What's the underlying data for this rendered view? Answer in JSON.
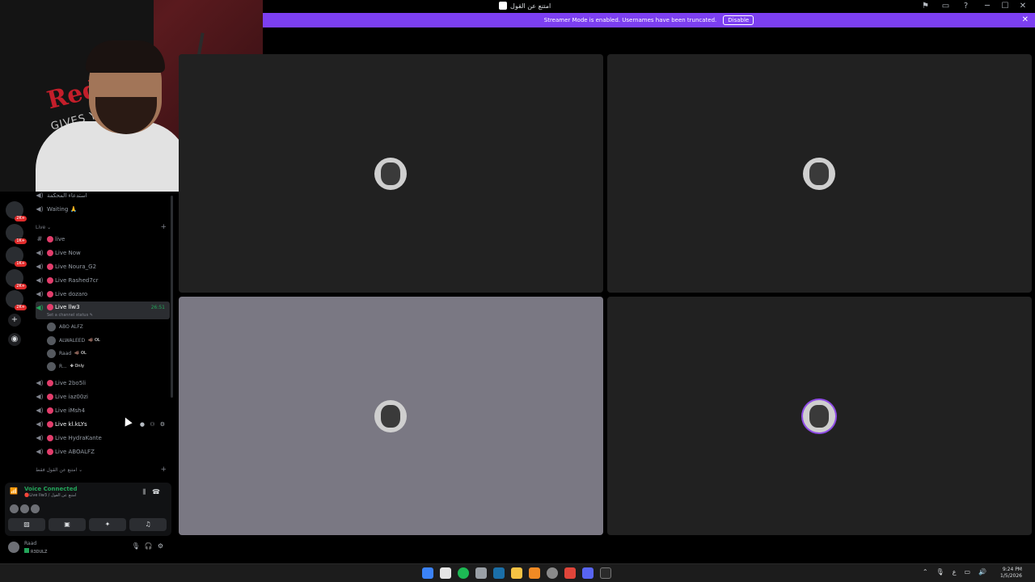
{
  "window": {
    "title": "امتنع عن القول",
    "controls": [
      "─",
      "☐",
      "✕"
    ]
  },
  "streamer_bar": {
    "message": "Streamer Mode is enabled. Usernames have been truncated.",
    "disable_label": "Disable"
  },
  "server_badges": [
    "2K+",
    "1K+",
    "1K+",
    "2K+",
    "2K+"
  ],
  "channels": {
    "top": [
      {
        "name": "استدعاء المحكمة",
        "icon": "speaker-icon"
      },
      {
        "name": "Waiting 🙏",
        "icon": "speaker-icon"
      }
    ],
    "category_live": "Live ⌄",
    "text_channel": "live",
    "live_channels_before": [
      "Live Now",
      "Live Noura_G2",
      "Live Rashed7cr",
      "Live dozaro"
    ],
    "active_channel": {
      "name": "Live llw3",
      "time": "26:51",
      "status": "Set a channel status ✎"
    },
    "voice_users": [
      {
        "name": "ABO ALFZ",
        "tag": ""
      },
      {
        "name": "ALWALEED",
        "tag": "🐗 OL"
      },
      {
        "name": "Raad",
        "tag": "🐗 OL"
      },
      {
        "name": "R...",
        "tag": "✤ Only"
      }
    ],
    "live_channels_after": [
      "Live 2bo5li",
      "Live iaz00zi",
      "Live iMsh4"
    ],
    "hover_channel": "Live kl.kLYs",
    "live_channels_end": [
      "Live HydraKante",
      "Live ABOALFZ"
    ],
    "category_bottom": "امتنع عن القول فقط ⌄"
  },
  "voice_panel": {
    "title": "Voice Connected",
    "subtitle": "🔴Live llw3 / امتنع عن القول"
  },
  "user_panel": {
    "name": "Raad",
    "status": "R3DULZ"
  },
  "taskbar": {
    "time": "9:24 PM",
    "date": "1/5/2026",
    "lang": "ع"
  },
  "colors": {
    "streamer_bar": "#7c3ff2",
    "voice_green": "#23a55a",
    "live_dot": "#e23d6b"
  }
}
